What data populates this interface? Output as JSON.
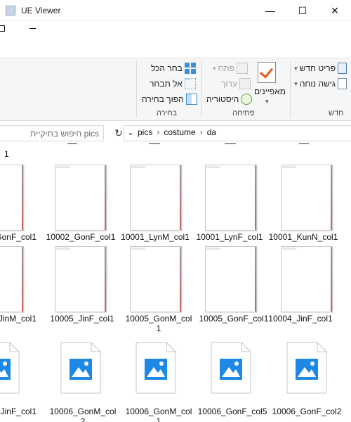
{
  "window": {
    "title": "UE Viewer",
    "minimize_glyph": "—",
    "maximize_glyph": "☐",
    "close_glyph": "✕"
  },
  "ribbon": {
    "new_group": {
      "label": "חדש",
      "items": [
        "פריט חדש",
        "גישה נוחה"
      ]
    },
    "open_group": {
      "label": "פתיחה",
      "properties": "מאפיינים",
      "open": "פתח",
      "edit": "ערוך",
      "history": "היסטוריה"
    },
    "select_group": {
      "label": "בחירה",
      "select_all": "בחר הכל",
      "select_none": "אל תבחר",
      "invert": "הפוך בחירה"
    }
  },
  "addressbar": {
    "search_placeholder": "חיפוש בתיקיית pics",
    "breadcrumbs": [
      "da",
      "costume",
      "pics"
    ],
    "separator": "›"
  },
  "files": {
    "top_fragment": "1",
    "row1": [
      "10001_KunN_col1",
      "10001_LynF_col1",
      "10001_LynM_col1",
      "10002_GonF_col1",
      "GonF_col1"
    ],
    "row2": [
      "10004_JinF_col1",
      "10005_GonF_col1",
      "10005_GonM_col 1",
      "10005_JinF_col1",
      "JinM_col1"
    ],
    "row3": [
      "10006_GonF_col2",
      "10006_GonF_col5",
      "10006_GonM_col 1",
      "10006_GonM_col 2",
      "JinF_col1"
    ]
  },
  "colors": {
    "accent": "#0078d7",
    "image_icon_blue": "#1e88e5"
  }
}
